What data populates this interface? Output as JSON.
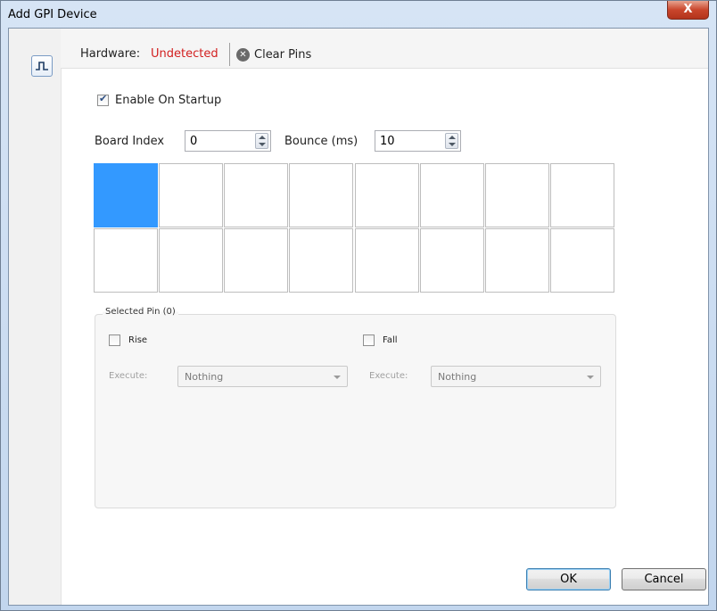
{
  "window": {
    "title": "Add GPI Device",
    "close_glyph": "X"
  },
  "toolbar": {
    "hardware_label": "Hardware:",
    "hardware_status": "Undetected",
    "clear_pins_label": "Clear Pins"
  },
  "settings": {
    "enable_on_startup_label": "Enable On Startup",
    "enable_on_startup_checked": true,
    "board_index_label": "Board Index",
    "board_index_value": "0",
    "bounce_label": "Bounce (ms)",
    "bounce_value": "10"
  },
  "pins": {
    "rows": 2,
    "columns": 8,
    "selected_index": 0
  },
  "selected_pin": {
    "title": "Selected Pin (0)",
    "rise_label": "Rise",
    "rise_checked": false,
    "fall_label": "Fall",
    "fall_checked": false,
    "execute_label": "Execute:",
    "rise_execute_value": "Nothing",
    "fall_execute_value": "Nothing"
  },
  "buttons": {
    "ok": "OK",
    "cancel": "Cancel"
  },
  "colors": {
    "status_error": "#d21f1f",
    "selected_pin": "#3399ff"
  }
}
